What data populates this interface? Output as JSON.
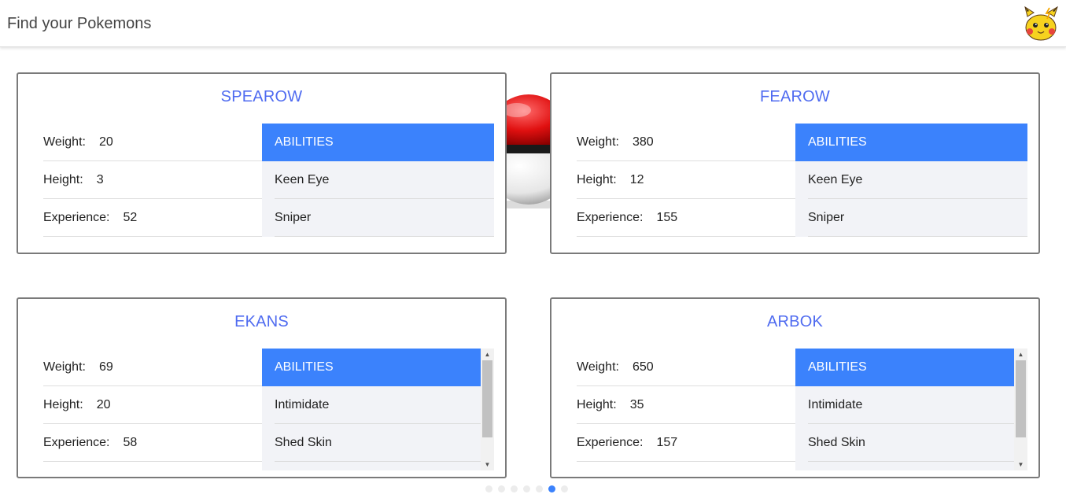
{
  "header": {
    "title": "Find your Pokemons",
    "logo_icon": "pikachu-icon"
  },
  "labels": {
    "weight": "Weight:",
    "height": "Height:",
    "experience": "Experience:",
    "abilities": "ABILITIES"
  },
  "pokemons": [
    {
      "name": "SPEAROW",
      "weight": "20",
      "height": "3",
      "experience": "52",
      "abilities": [
        "Keen Eye",
        "Sniper"
      ]
    },
    {
      "name": "FEAROW",
      "weight": "380",
      "height": "12",
      "experience": "155",
      "abilities": [
        "Keen Eye",
        "Sniper"
      ]
    },
    {
      "name": "EKANS",
      "weight": "69",
      "height": "20",
      "experience": "58",
      "abilities": [
        "Intimidate",
        "Shed Skin"
      ]
    },
    {
      "name": "ARBOK",
      "weight": "650",
      "height": "35",
      "experience": "157",
      "abilities": [
        "Intimidate",
        "Shed Skin"
      ]
    }
  ],
  "pagination": {
    "total": 7,
    "active_index": 5
  },
  "colors": {
    "accent": "#3b82fc",
    "title": "#4f6bf0",
    "ability_bg": "#f2f3f7"
  }
}
